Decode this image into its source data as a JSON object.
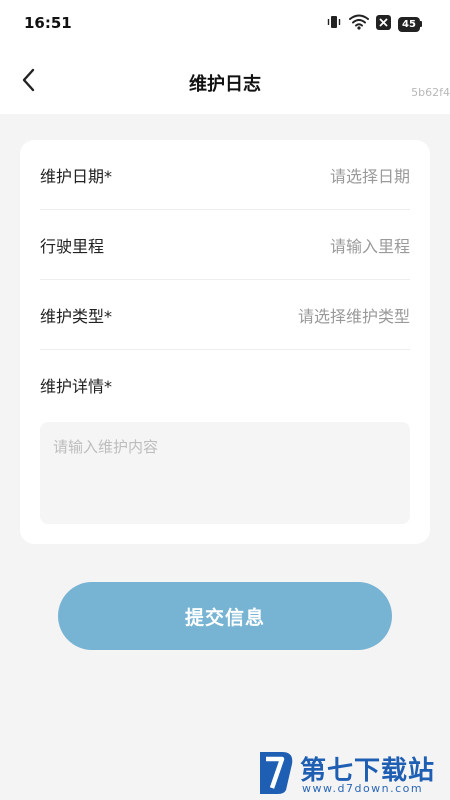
{
  "status_bar": {
    "time": "16:51",
    "battery_level": "45",
    "icons": [
      "vibrate-icon",
      "wifi-icon",
      "close-box-icon",
      "battery-icon"
    ]
  },
  "navbar": {
    "title": "维护日志",
    "debug_id": "5b62f4",
    "back_icon": "chevron-left-icon"
  },
  "form": {
    "date": {
      "label": "维护日期*",
      "placeholder": "请选择日期"
    },
    "mileage": {
      "label": "行驶里程",
      "placeholder": "请输入里程"
    },
    "type": {
      "label": "维护类型*",
      "placeholder": "请选择维护类型"
    },
    "details": {
      "label": "维护详情*",
      "placeholder": "请输入维护内容",
      "value": ""
    }
  },
  "submit": {
    "label": "提交信息"
  },
  "watermark": {
    "name": "第七下载站",
    "url": "www.d7down.com"
  },
  "colors": {
    "accent": "#77b3d3",
    "background": "#f4f4f4",
    "watermark": "#1f5fb3"
  }
}
